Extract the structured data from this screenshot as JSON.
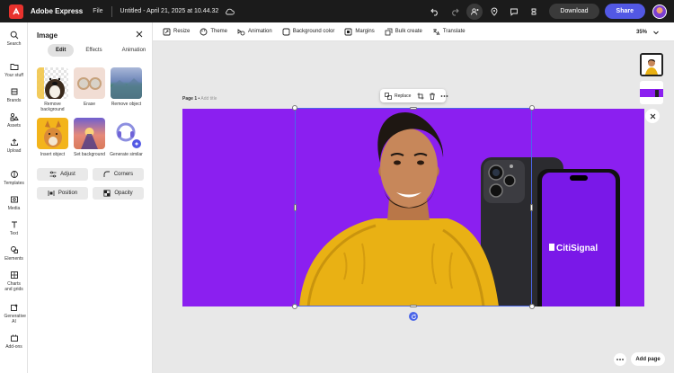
{
  "app": {
    "name": "Adobe Express",
    "file_menu": "File",
    "document_title": "Untitled - April 21, 2025 at 10.44.32",
    "download_label": "Download",
    "share_label": "Share"
  },
  "rail": {
    "items": [
      {
        "label": "Search",
        "icon": "search-icon"
      },
      {
        "label": "Your stuff",
        "icon": "folder-icon"
      },
      {
        "label": "Brands",
        "icon": "brand-icon"
      },
      {
        "label": "Assets",
        "icon": "assets-icon"
      },
      {
        "label": "Upload",
        "icon": "upload-icon"
      },
      {
        "label": "Templates",
        "icon": "templates-icon"
      },
      {
        "label": "Media",
        "icon": "media-icon"
      },
      {
        "label": "Text",
        "icon": "text-icon"
      },
      {
        "label": "Elements",
        "icon": "elements-icon"
      },
      {
        "label": "Charts and grids",
        "icon": "charts-icon"
      },
      {
        "label": "Generative AI",
        "icon": "generative-ai-icon"
      },
      {
        "label": "Add-ons",
        "icon": "add-ons-icon"
      }
    ]
  },
  "panel": {
    "title": "Image",
    "tabs": [
      "Edit",
      "Effects",
      "Animation"
    ],
    "active_tab": "Edit",
    "tools": [
      {
        "label": "Remove background"
      },
      {
        "label": "Erase"
      },
      {
        "label": "Remove object"
      },
      {
        "label": "Insert object"
      },
      {
        "label": "Set background"
      },
      {
        "label": "Generate similar"
      }
    ],
    "buttons": [
      "Adjust",
      "Corners",
      "Position",
      "Opacity"
    ]
  },
  "toolbar": {
    "items": [
      "Resize",
      "Theme",
      "Animation",
      "Background color",
      "Margins",
      "Bulk create",
      "Translate"
    ],
    "zoom": "35%"
  },
  "canvas": {
    "page_label": "Page 1",
    "add_title": "Add title",
    "replace_label": "Replace",
    "artboard_color": "#8b1ff0",
    "phone_brand": "CitiSignal",
    "add_page_label": "Add page"
  },
  "colors": {
    "accent": "#5258e4",
    "selection": "#4b66e8"
  }
}
